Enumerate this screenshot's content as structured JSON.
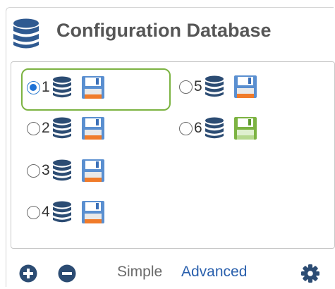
{
  "title": "Configuration Database",
  "slots": [
    {
      "number": "1",
      "selected": true,
      "highlighted": true,
      "save_icon": "floppy-disk-icon"
    },
    {
      "number": "2",
      "selected": false,
      "highlighted": false,
      "save_icon": "floppy-disk-icon"
    },
    {
      "number": "3",
      "selected": false,
      "highlighted": false,
      "save_icon": "floppy-disk-icon"
    },
    {
      "number": "4",
      "selected": false,
      "highlighted": false,
      "save_icon": "floppy-disk-icon"
    },
    {
      "number": "5",
      "selected": false,
      "highlighted": false,
      "save_icon": "floppy-disk-icon"
    },
    {
      "number": "6",
      "selected": false,
      "highlighted": false,
      "save_icon": "floppy-disk-green-icon"
    }
  ],
  "footer": {
    "add_icon": "plus-circle-icon",
    "remove_icon": "minus-circle-icon",
    "simple_label": "Simple",
    "advanced_label": "Advanced",
    "settings_icon": "gear-icon"
  },
  "colors": {
    "database": "#2c4c73",
    "selection": "#1e72d6",
    "highlight": "#7cb342",
    "advanced_link": "#2a60ad",
    "save_green": "#7cb342"
  }
}
